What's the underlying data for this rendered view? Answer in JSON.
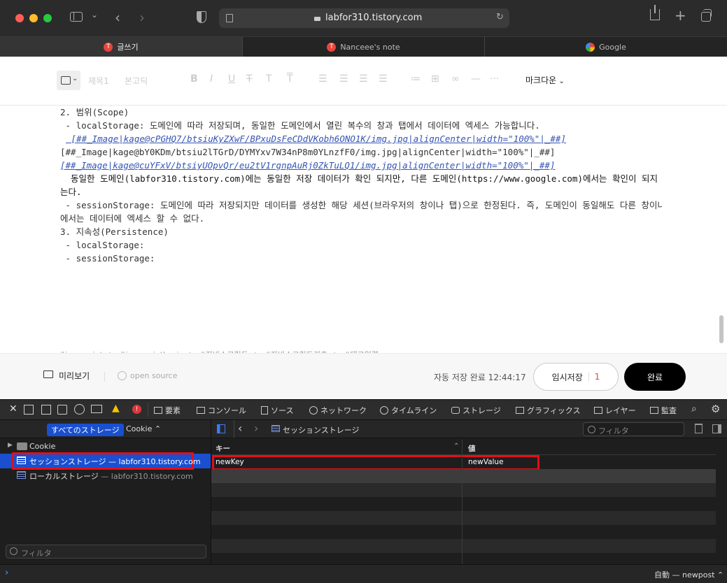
{
  "browser": {
    "url": "labfor310.tistory.com",
    "tabs": [
      {
        "label": "글쓰기"
      },
      {
        "label": "Nanceee's note"
      },
      {
        "label": "Google"
      }
    ]
  },
  "editor": {
    "toolbar": {
      "heading": "제목1",
      "font": "본고딕",
      "markdown": "마크다운"
    },
    "lines": [
      "2. 범위(Scope)",
      " - localStorage: 도메인에 따라 저장되며, 동일한 도메인에서 열린 복수의 창과 탭에서 데이터에 엑세스 가능합니다.",
      " [##_Image|kage@cPGHQ7/btsiuKyZXwF/BPxuDsFeCDdVKobh6ONO1K/img.jpg|alignCenter|width=\"100%\"|_##]",
      "[##_Image|kage@bY0KDm/btsiu2lTGrD/DYMYxv7W34nP8m0YLnzfF0/img.jpg|alignCenter|width=\"100%\"|_##]",
      "[##_Image|kage@cuYFxV/btsiyUOpvQr/eu2tV1rgnpAuRj0ZkTuLQ1/img.jpg|alignCenter|width=\"100%\"|_##]",
      "  동일한 도메인(labfor310.tistory.com)에는 동일한 저장 데이터가 확인 되지만, 다른 도메인(https://www.google.com)에서는 확인이 되지 않",
      "는다.",
      "",
      " - sessionStorage: 도메인에 따라 저장되지만 데이터를 생성한 해당 세션(브라우저의 창이나 탭)으로 한정된다. 즉, 도메인이 동일해도 다른 창이나 탭",
      "에서는 데이터에 엑세스 할 수 없다.",
      "",
      "",
      "3. 지속성(Persistence)",
      " - localStorage:",
      " - sessionStorage:"
    ],
    "tags": "#javascript ✓   #javascriptbasic ✓   #자바스크립트 ✓   #자바스크립트기초 ✓   #태그입력",
    "footer": {
      "preview": "미리보기",
      "open_source": "open source",
      "autosave": "자동 저장 완료 12:44:17",
      "draft_label": "임시저장",
      "draft_count": "1",
      "done": "완료"
    }
  },
  "devtools": {
    "tabs": [
      "要素",
      "コンソール",
      "ソース",
      "ネットワーク",
      "タイムライン",
      "ストレージ",
      "グラフィックス",
      "レイヤー",
      "監査"
    ],
    "warning_count": "",
    "storage_filter": "すべてのストレージ",
    "cookie_filter": "Cookie",
    "tree": [
      {
        "label": "Cookie"
      },
      {
        "label": "セッションストレージ — labfor310.tistory.com"
      },
      {
        "label": "ローカルストレージ",
        "domain": " — labfor310.tistory.com"
      }
    ],
    "sidebar_filter_placeholder": "フィルタ",
    "breadcrumb": "セッションストレージ",
    "main_filter_placeholder": "フィルタ",
    "table": {
      "col_key": "キー",
      "col_value": "値",
      "rows": [
        {
          "key": "newKey",
          "value": "newValue"
        }
      ]
    },
    "console_context": "自動 — newpost"
  },
  "colors": {
    "highlight": "#e0101a",
    "selection": "#1a4fd0",
    "done_button": "#000000"
  }
}
